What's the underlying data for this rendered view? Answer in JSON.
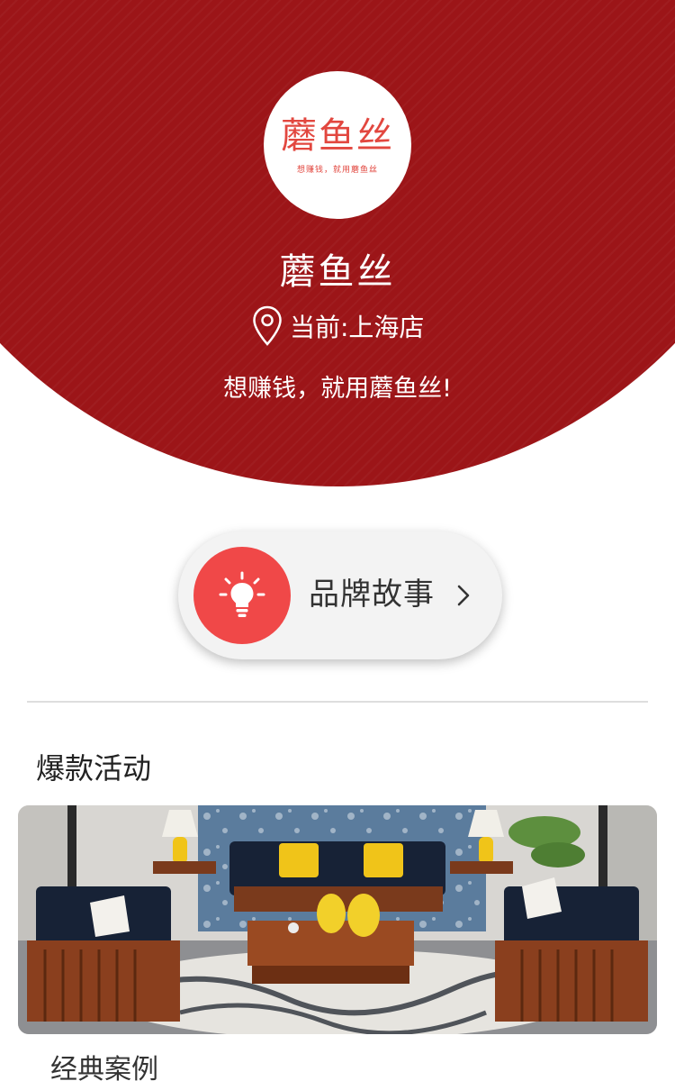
{
  "store": {
    "logo_text": "蘑鱼丝",
    "logo_slogan": "想赚钱，就用蘑鱼丝",
    "name": "蘑鱼丝",
    "location": "当前:上海店",
    "tagline": "想赚钱，就用蘑鱼丝!"
  },
  "brand_story": {
    "label": "品牌故事",
    "icon": "lightbulb-icon",
    "chevron_icon": "chevron-right-icon"
  },
  "sections": {
    "hot_activity": "爆款活动",
    "classic_cases": "经典案例"
  },
  "banner": {
    "description_icon": "furniture-photo"
  },
  "colors": {
    "header_red": "#9c1518",
    "accent_red": "#f04848",
    "logo_red": "#e2473f"
  }
}
